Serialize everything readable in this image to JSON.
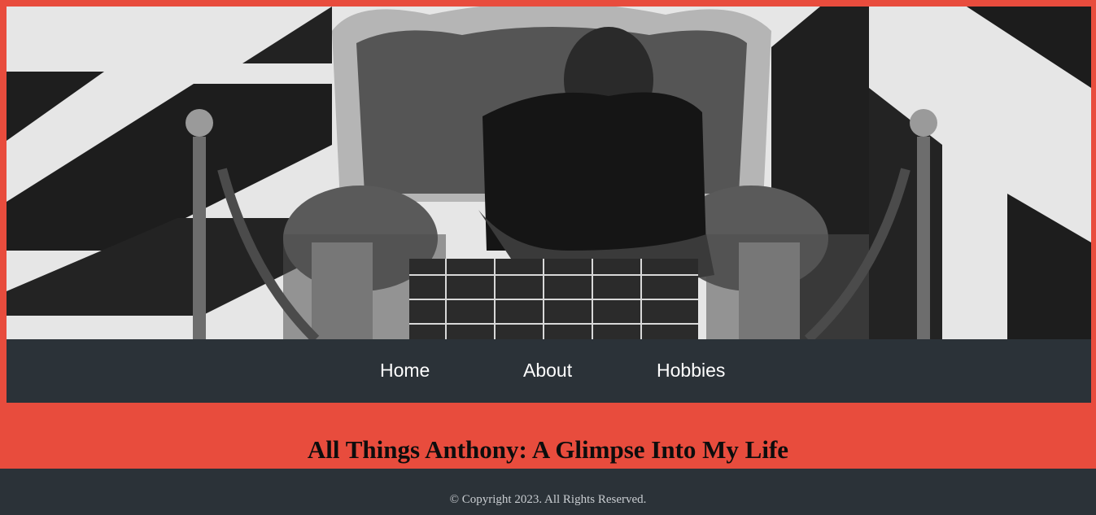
{
  "hero": {
    "image_alt": "Black and white photo of a man seated on an ornate throne chair between rope stanchions"
  },
  "nav": {
    "items": [
      {
        "label": "Home"
      },
      {
        "label": "About"
      },
      {
        "label": "Hobbies"
      }
    ]
  },
  "main": {
    "title": "All Things Anthony: A Glimpse Into My Life"
  },
  "footer": {
    "copyright": "© Copyright 2023. All Rights Reserved."
  },
  "colors": {
    "accent": "#e84c3d",
    "nav_bg": "#2b3238",
    "footer_text": "#c9cdd1"
  }
}
